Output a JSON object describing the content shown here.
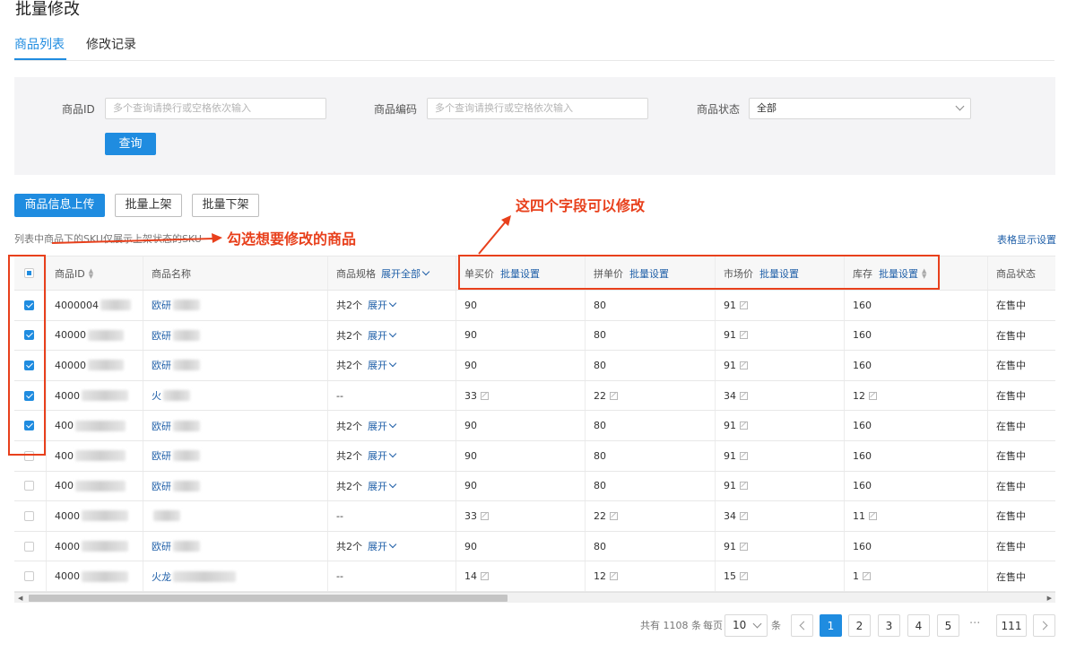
{
  "page": {
    "title": "批量修改"
  },
  "tabs": [
    {
      "label": "商品列表"
    },
    {
      "label": "修改记录"
    }
  ],
  "filter": {
    "product_id_label": "商品ID",
    "product_id_placeholder": "多个查询请换行或空格依次输入",
    "product_code_label": "商品编码",
    "product_code_placeholder": "多个查询请换行或空格依次输入",
    "status_label": "商品状态",
    "status_value": "全部",
    "query_button": "查询"
  },
  "actions": {
    "upload": "商品信息上传",
    "batch_on": "批量上架",
    "batch_off": "批量下架"
  },
  "hint": "列表中商品下的SKU仅展示上架状态的SKU",
  "table_settings": "表格显示设置",
  "columns": {
    "product_id": "商品ID",
    "product_name": "商品名称",
    "spec": "商品规格",
    "expand_all": "展开全部",
    "single_price": "单买价",
    "group_price": "拼单价",
    "market_price": "市场价",
    "stock": "库存",
    "batch_set": "批量设置",
    "status": "商品状态"
  },
  "rows": [
    {
      "id": "4000004",
      "name": "欧研",
      "spec_count": "共2个",
      "expand": "展开",
      "single": "90",
      "group": "80",
      "market": "91",
      "stock": "160",
      "status": "在售中",
      "checked": true
    },
    {
      "id": "40000",
      "name": "欧研",
      "spec_count": "共2个",
      "expand": "展开",
      "single": "90",
      "group": "80",
      "market": "91",
      "stock": "160",
      "status": "在售中",
      "checked": true
    },
    {
      "id": "40000",
      "name": "欧研",
      "spec_count": "共2个",
      "expand": "展开",
      "single": "90",
      "group": "80",
      "market": "91",
      "stock": "160",
      "status": "在售中",
      "checked": true
    },
    {
      "id": "4000",
      "name": "火",
      "spec_count": "--",
      "expand": "",
      "single": "33",
      "group": "22",
      "market": "34",
      "stock": "12",
      "status": "在售中",
      "checked": true
    },
    {
      "id": "400",
      "name": "欧研",
      "spec_count": "共2个",
      "expand": "展开",
      "single": "90",
      "group": "80",
      "market": "91",
      "stock": "160",
      "status": "在售中",
      "checked": true
    },
    {
      "id": "400",
      "name": "欧研",
      "spec_count": "共2个",
      "expand": "展开",
      "single": "90",
      "group": "80",
      "market": "91",
      "stock": "160",
      "status": "在售中",
      "checked": false
    },
    {
      "id": "400",
      "name": "欧研",
      "spec_count": "共2个",
      "expand": "展开",
      "single": "90",
      "group": "80",
      "market": "91",
      "stock": "160",
      "status": "在售中",
      "checked": false
    },
    {
      "id": "4000",
      "name": "",
      "spec_count": "--",
      "expand": "",
      "single": "33",
      "group": "22",
      "market": "34",
      "stock": "11",
      "status": "在售中",
      "checked": false
    },
    {
      "id": "4000",
      "name": "欧研",
      "spec_count": "共2个",
      "expand": "展开",
      "single": "90",
      "group": "80",
      "market": "91",
      "stock": "160",
      "status": "在售中",
      "checked": false
    },
    {
      "id": "4000",
      "name": "火龙",
      "spec_count": "--",
      "expand": "",
      "single": "14",
      "group": "12",
      "market": "15",
      "stock": "1",
      "status": "在售中",
      "checked": false
    }
  ],
  "pagination": {
    "total_prefix": "共有",
    "total": "1108",
    "total_suffix": "条",
    "per_page_label": "每页",
    "per_page": "10",
    "per_page_unit": "条",
    "pages": [
      "1",
      "2",
      "3",
      "4",
      "5"
    ],
    "ellipsis": "···",
    "last_page": "111",
    "current": "1"
  },
  "annotations": {
    "select_hint": "勾选想要修改的商品",
    "fields_hint": "这四个字段可以修改",
    "color": "#e8401c"
  },
  "colors": {
    "primary": "#1f8ce0",
    "link": "#1f5fa8"
  }
}
